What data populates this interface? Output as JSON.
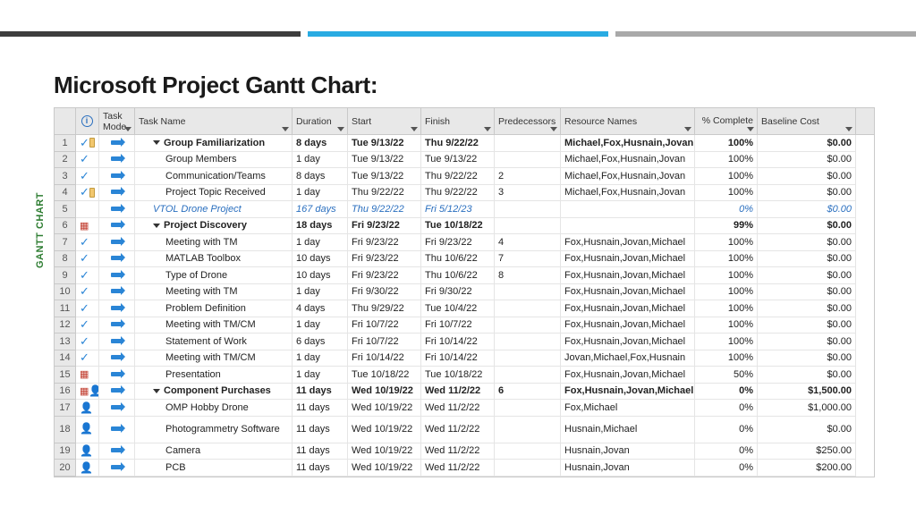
{
  "page_title": "Microsoft Project Gantt Chart:",
  "side_label": "GANTT CHART",
  "headers": {
    "info_tip": "i",
    "task_mode": "Task Mode",
    "task_name": "Task Name",
    "duration": "Duration",
    "start": "Start",
    "finish": "Finish",
    "predecessors": "Predecessors",
    "resource_names": "Resource Names",
    "pct_complete": "% Complete",
    "baseline_cost": "Baseline Cost"
  },
  "rows": [
    {
      "n": "1",
      "icons": [
        "chk",
        "note"
      ],
      "task": "Group Familiarization",
      "dur": "8 days",
      "start": "Tue 9/13/22",
      "fin": "Thu 9/22/22",
      "pred": "",
      "res": "Michael,Fox,Husnain,Jovan",
      "pct": "100%",
      "base": "$0.00",
      "bold": true,
      "lvl": 1,
      "parent": true
    },
    {
      "n": "2",
      "icons": [
        "chk"
      ],
      "task": "Group Members",
      "dur": "1 day",
      "start": "Tue 9/13/22",
      "fin": "Tue 9/13/22",
      "pred": "",
      "res": "Michael,Fox,Husnain,Jovan",
      "pct": "100%",
      "base": "$0.00",
      "lvl": 2
    },
    {
      "n": "3",
      "icons": [
        "chk"
      ],
      "task": "Communication/Teams",
      "dur": "8 days",
      "start": "Tue 9/13/22",
      "fin": "Thu 9/22/22",
      "pred": "2",
      "res": "Michael,Fox,Husnain,Jovan",
      "pct": "100%",
      "base": "$0.00",
      "lvl": 2
    },
    {
      "n": "4",
      "icons": [
        "chk",
        "note"
      ],
      "task": "Project Topic Received",
      "dur": "1 day",
      "start": "Thu 9/22/22",
      "fin": "Thu 9/22/22",
      "pred": "3",
      "res": "Michael,Fox,Husnain,Jovan",
      "pct": "100%",
      "base": "$0.00",
      "lvl": 2
    },
    {
      "n": "5",
      "icons": [],
      "task": "VTOL Drone Project",
      "dur": "167 days",
      "start": "Thu 9/22/22",
      "fin": "Fri 5/12/23",
      "pred": "",
      "res": "",
      "pct": "0%",
      "base": "$0.00",
      "italic": true,
      "lvl": 1
    },
    {
      "n": "6",
      "icons": [
        "cal"
      ],
      "task": "Project Discovery",
      "dur": "18 days",
      "start": "Fri 9/23/22",
      "fin": "Tue 10/18/22",
      "pred": "",
      "res": "",
      "pct": "99%",
      "base": "$0.00",
      "bold": true,
      "lvl": 1,
      "parent": true
    },
    {
      "n": "7",
      "icons": [
        "chk"
      ],
      "task": "Meeting with TM",
      "dur": "1 day",
      "start": "Fri 9/23/22",
      "fin": "Fri 9/23/22",
      "pred": "4",
      "res": "Fox,Husnain,Jovan,Michael",
      "pct": "100%",
      "base": "$0.00",
      "lvl": 2
    },
    {
      "n": "8",
      "icons": [
        "chk"
      ],
      "task": "MATLAB Toolbox",
      "dur": "10 days",
      "start": "Fri 9/23/22",
      "fin": "Thu 10/6/22",
      "pred": "7",
      "res": "Fox,Husnain,Jovan,Michael",
      "pct": "100%",
      "base": "$0.00",
      "lvl": 2
    },
    {
      "n": "9",
      "icons": [
        "chk"
      ],
      "task": "Type of Drone",
      "dur": "10 days",
      "start": "Fri 9/23/22",
      "fin": "Thu 10/6/22",
      "pred": "8",
      "res": "Fox,Husnain,Jovan,Michael",
      "pct": "100%",
      "base": "$0.00",
      "lvl": 2
    },
    {
      "n": "10",
      "icons": [
        "chk"
      ],
      "task": "Meeting with TM",
      "dur": "1 day",
      "start": "Fri 9/30/22",
      "fin": "Fri 9/30/22",
      "pred": "",
      "res": "Fox,Husnain,Jovan,Michael",
      "pct": "100%",
      "base": "$0.00",
      "lvl": 2
    },
    {
      "n": "11",
      "icons": [
        "chk"
      ],
      "task": "Problem Definition",
      "dur": "4 days",
      "start": "Thu 9/29/22",
      "fin": "Tue 10/4/22",
      "pred": "",
      "res": "Fox,Husnain,Jovan,Michael",
      "pct": "100%",
      "base": "$0.00",
      "lvl": 2
    },
    {
      "n": "12",
      "icons": [
        "chk"
      ],
      "task": "Meeting with TM/CM",
      "dur": "1 day",
      "start": "Fri 10/7/22",
      "fin": "Fri 10/7/22",
      "pred": "",
      "res": "Fox,Husnain,Jovan,Michael",
      "pct": "100%",
      "base": "$0.00",
      "lvl": 2
    },
    {
      "n": "13",
      "icons": [
        "chk"
      ],
      "task": "Statement of Work",
      "dur": "6 days",
      "start": "Fri 10/7/22",
      "fin": "Fri 10/14/22",
      "pred": "",
      "res": "Fox,Husnain,Jovan,Michael",
      "pct": "100%",
      "base": "$0.00",
      "lvl": 2
    },
    {
      "n": "14",
      "icons": [
        "chk"
      ],
      "task": "Meeting with TM/CM",
      "dur": "1 day",
      "start": "Fri 10/14/22",
      "fin": "Fri 10/14/22",
      "pred": "",
      "res": "Jovan,Michael,Fox,Husnain",
      "pct": "100%",
      "base": "$0.00",
      "lvl": 2
    },
    {
      "n": "15",
      "icons": [
        "cal"
      ],
      "task": "Presentation",
      "dur": "1 day",
      "start": "Tue 10/18/22",
      "fin": "Tue 10/18/22",
      "pred": "",
      "res": "Fox,Husnain,Jovan,Michael",
      "pct": "50%",
      "base": "$0.00",
      "lvl": 2
    },
    {
      "n": "16",
      "icons": [
        "cal",
        "pers"
      ],
      "task": "Component Purchases",
      "dur": "11 days",
      "start": "Wed 10/19/22",
      "fin": "Wed 11/2/22",
      "pred": "6",
      "res": "Fox,Husnain,Jovan,Michael",
      "pct": "0%",
      "base": "$1,500.00",
      "bold": true,
      "lvl": 1,
      "parent": true
    },
    {
      "n": "17",
      "icons": [
        "pers"
      ],
      "task": "OMP Hobby Drone",
      "dur": "11 days",
      "start": "Wed 10/19/22",
      "fin": "Wed 11/2/22",
      "pred": "",
      "res": "Fox,Michael",
      "pct": "0%",
      "base": "$1,000.00",
      "lvl": 2
    },
    {
      "n": "18",
      "icons": [
        "pers"
      ],
      "task": "Photogrammetry Software",
      "dur": "11 days",
      "start": "Wed 10/19/22",
      "fin": "Wed 11/2/22",
      "pred": "",
      "res": "Husnain,Michael",
      "pct": "0%",
      "base": "$0.00",
      "lvl": 2,
      "tall": true
    },
    {
      "n": "19",
      "icons": [
        "pers"
      ],
      "task": "Camera",
      "dur": "11 days",
      "start": "Wed 10/19/22",
      "fin": "Wed 11/2/22",
      "pred": "",
      "res": "Husnain,Jovan",
      "pct": "0%",
      "base": "$250.00",
      "lvl": 2
    },
    {
      "n": "20",
      "icons": [
        "pers"
      ],
      "task": "PCB",
      "dur": "11 days",
      "start": "Wed 10/19/22",
      "fin": "Wed 11/2/22",
      "pred": "",
      "res": "Husnain,Jovan",
      "pct": "0%",
      "base": "$200.00",
      "lvl": 2
    }
  ]
}
